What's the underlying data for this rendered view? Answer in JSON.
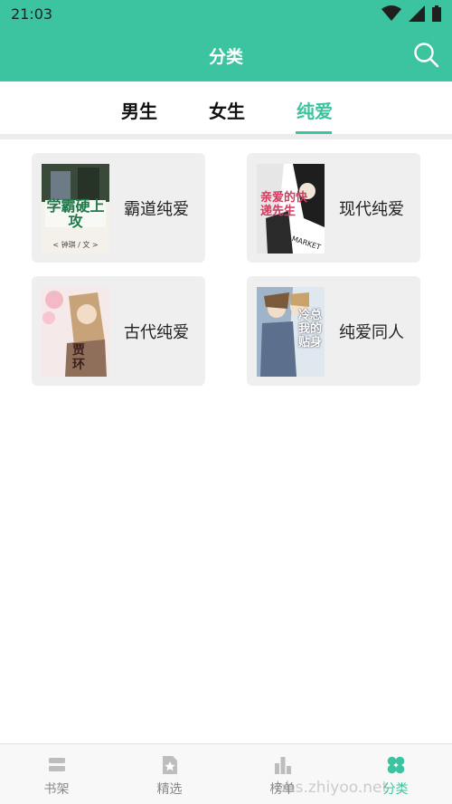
{
  "status_bar": {
    "time": "21:03",
    "icons": [
      "wifi-icon",
      "signal-icon",
      "battery-icon"
    ]
  },
  "app_bar": {
    "title": "分类",
    "search_icon": "search-icon"
  },
  "tabs": [
    {
      "label": "男生",
      "active": false
    },
    {
      "label": "女生",
      "active": false
    },
    {
      "label": "纯爱",
      "active": true
    }
  ],
  "categories": [
    {
      "label": "霸道纯爱",
      "cover_text": "学霸硬上攻",
      "cover_sub": "< 钟琪 / 文 >"
    },
    {
      "label": "现代纯爱",
      "cover_text": "亲爱的快递先生",
      "cover_sub": "MARKET"
    },
    {
      "label": "古代纯爱",
      "cover_text": "贾环",
      "cover_sub": ""
    },
    {
      "label": "纯爱同人",
      "cover_text": "冷总我的贴身",
      "cover_sub": ""
    }
  ],
  "bottom_nav": [
    {
      "label": "书架",
      "icon": "bookshelf-icon",
      "active": false
    },
    {
      "label": "精选",
      "icon": "featured-star-icon",
      "active": false
    },
    {
      "label": "榜单",
      "icon": "ranking-bars-icon",
      "active": false
    },
    {
      "label": "分类",
      "icon": "category-clover-icon",
      "active": true
    }
  ],
  "watermark": "bbs.zhiyoo.net",
  "colors": {
    "accent": "#3cc3a0",
    "card_bg": "#efefef",
    "inactive_nav": "#888888"
  }
}
